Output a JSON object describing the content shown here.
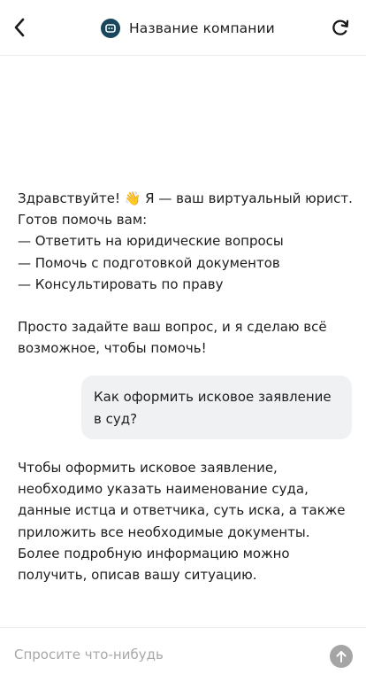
{
  "header": {
    "back_icon": "chevron-left-icon",
    "logo_icon": "bot-face-icon",
    "title": "Название компании",
    "refresh_icon": "refresh-icon"
  },
  "messages": [
    {
      "role": "assistant",
      "text": "Здравствуйте! 👋 Я — ваш виртуальный юрист.\nГотов помочь вам:\n— Ответить на юридические вопросы\n— Помочь с подготовкой документов\n— Консультировать по праву\n\nПросто задайте ваш вопрос, и я сделаю всё\nвозможное, чтобы помочь!"
    },
    {
      "role": "user",
      "text": "Как оформить исковое заявление в суд?"
    },
    {
      "role": "assistant",
      "text": "Чтобы оформить исковое заявление,\nнеобходимо указать наименование суда,\nданные истца и ответчика, суть иска, а также\nприложить все необходимые документы.\nБолее подробную информацию можно\nполучить, описав вашу ситуацию."
    }
  ],
  "input": {
    "value": "",
    "placeholder": "Спросите что-нибудь",
    "send_icon": "arrow-up-icon"
  },
  "colors": {
    "logo_bg": "#17465d",
    "user_bubble_bg": "#eff1f3",
    "send_button_bg": "#a5a5a5",
    "placeholder": "#a8a8a8"
  }
}
